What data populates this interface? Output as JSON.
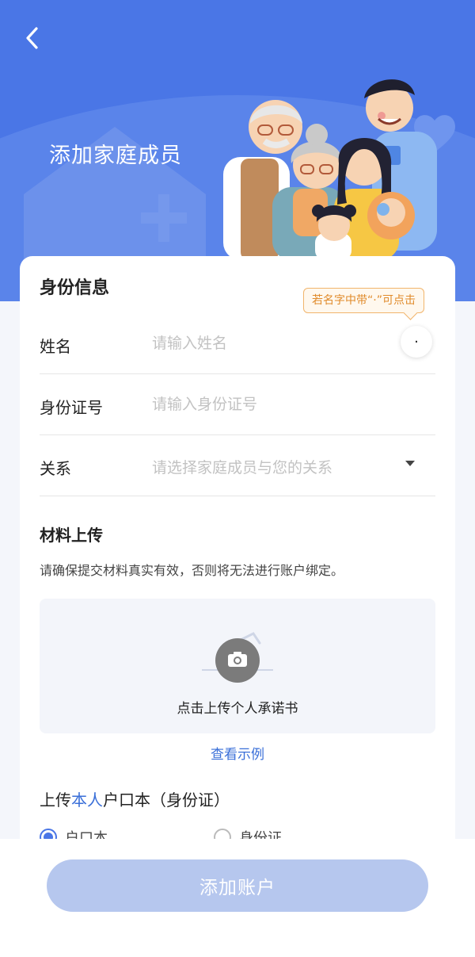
{
  "header": {
    "title": "添加家庭成员",
    "back_icon": "chevron-left-icon",
    "colors": {
      "background": "#4a76e6",
      "arc": "#5a84ea"
    }
  },
  "identity": {
    "section_title": "身份信息",
    "name_tip": "若名字中带“·”可点击",
    "name_label": "姓名",
    "name_placeholder": "请输入姓名",
    "middle_dot_button": "·",
    "id_label": "身份证号",
    "id_placeholder": "请输入身份证号",
    "relation_label": "关系",
    "relation_placeholder": "请选择家庭成员与您的关系",
    "relation_icon": "caret-down-icon"
  },
  "materials": {
    "section_title": "材料上传",
    "hint": "请确保提交材料真实有效，否则将无法进行账户绑定。",
    "upload_label": "点击上传个人承诺书",
    "upload_icon": "camera-icon",
    "example_link": "查看示例",
    "upload_title_prefix": "上传",
    "upload_title_highlight": "本人",
    "upload_title_suffix": "户口本（身份证）",
    "options": [
      {
        "label": "户口本",
        "selected": true
      },
      {
        "label": "身份证",
        "selected": false
      }
    ]
  },
  "footer": {
    "submit_label": "添加账户",
    "colors": {
      "button": "#b6c7ee",
      "link": "#3a6fd8",
      "tip": "#e08a2a"
    }
  }
}
